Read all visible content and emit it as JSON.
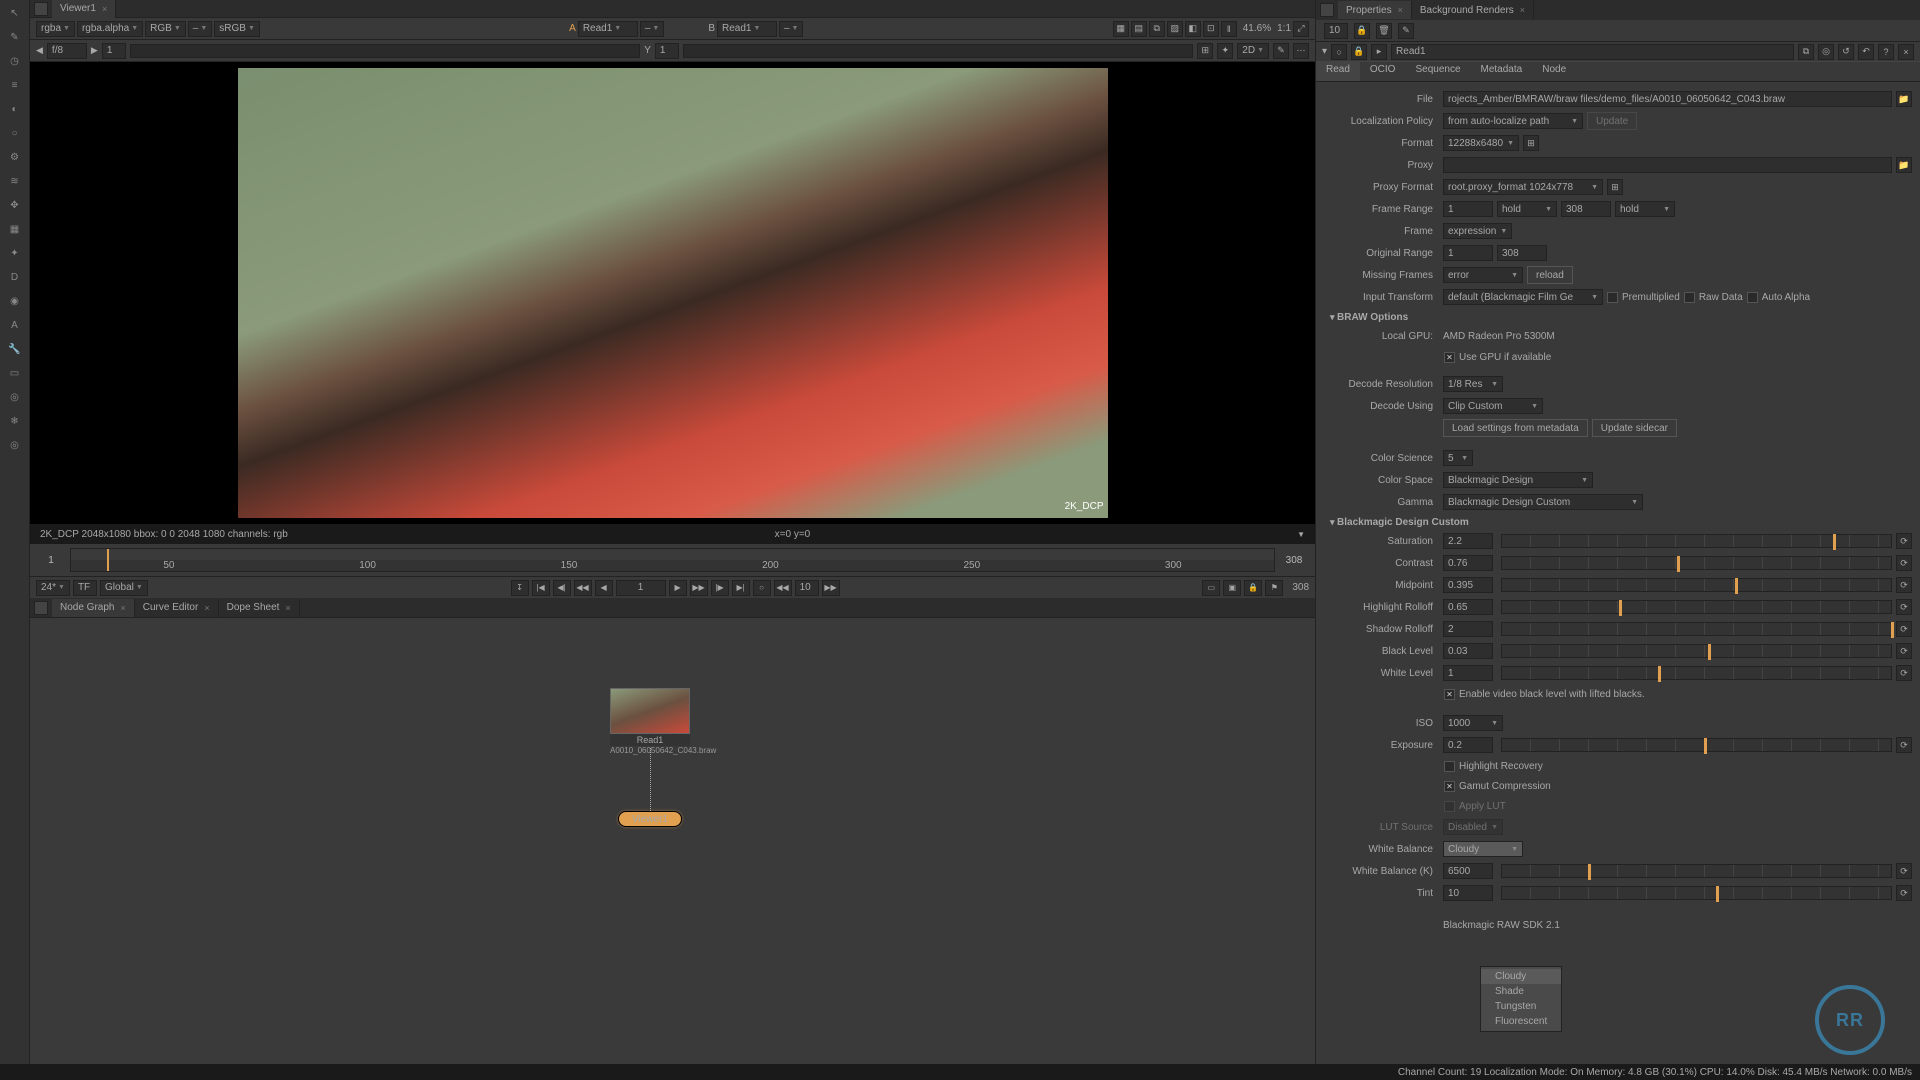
{
  "viewer_tab": "Viewer1",
  "viewer_toolbar": {
    "channel1": "rgba",
    "channel2": "rgba.alpha",
    "colorspace": "RGB",
    "display_lut": "sRGB",
    "a_label": "A",
    "a_node": "Read1",
    "b_label": "B",
    "b_node": "Read1",
    "gain_pct": "41.6%",
    "ratio": "1:1"
  },
  "viewer_toolbar2": {
    "fstop": "f/8",
    "frame": "1",
    "y_label": "Y",
    "y_val": "1",
    "view_mode": "2D"
  },
  "overlay": {
    "right": "2K_DCP"
  },
  "info_bar": {
    "left": "2K_DCP 2048x1080  bbox: 0 0 2048 1080 channels: rgb",
    "right": "x=0 y=0"
  },
  "timeline": {
    "start": "1",
    "end": "308",
    "ticks": [
      "50",
      "100",
      "150",
      "200",
      "250",
      "300"
    ],
    "frame_end": "308"
  },
  "playbar": {
    "fps": "24*",
    "tc": "TF",
    "scope": "Global",
    "current": "1",
    "skip": "10",
    "end": "308"
  },
  "lower_tabs": {
    "node_graph": "Node Graph",
    "curve_editor": "Curve Editor",
    "dope_sheet": "Dope Sheet"
  },
  "nodes": {
    "read_name": "Read1",
    "read_file": "A0010_06050642_C043.braw",
    "viewer_name": "Viewer1"
  },
  "right_tabs": {
    "properties": "Properties",
    "bg_renders": "Background Renders"
  },
  "right_header_num": "10",
  "prop_node": "Read1",
  "prop_tabs": {
    "read": "Read",
    "ocio": "OCIO",
    "sequence": "Sequence",
    "metadata": "Metadata",
    "node": "Node"
  },
  "props": {
    "file_label": "File",
    "file_value": "rojects_Amber/BMRAW/braw files/demo_files/A0010_06050642_C043.braw",
    "loc_policy_label": "Localization Policy",
    "loc_policy_value": "from auto-localize path",
    "update_btn": "Update",
    "format_label": "Format",
    "format_value": "12288x6480",
    "proxy_label": "Proxy",
    "proxy_format_label": "Proxy Format",
    "proxy_format_value": "root.proxy_format 1024x778",
    "frame_range_label": "Frame Range",
    "frame_range_a": "1",
    "frame_range_hold1": "hold",
    "frame_range_b": "308",
    "frame_range_hold2": "hold",
    "frame_label": "Frame",
    "frame_value": "expression",
    "orig_range_label": "Original Range",
    "orig_range_a": "1",
    "orig_range_b": "308",
    "missing_label": "Missing Frames",
    "missing_value": "error",
    "reload_btn": "reload",
    "input_xform_label": "Input Transform",
    "input_xform_value": "default (Blackmagic Film Ge",
    "premult": "Premultiplied",
    "raw_data": "Raw Data",
    "auto_alpha": "Auto Alpha",
    "braw_section": "BRAW Options",
    "local_gpu_label": "Local GPU:",
    "local_gpu_value": "AMD Radeon Pro 5300M",
    "use_gpu": "Use GPU if available",
    "decode_res_label": "Decode Resolution",
    "decode_res_value": "1/8 Res",
    "decode_using_label": "Decode Using",
    "decode_using_value": "Clip Custom",
    "load_settings_btn": "Load settings from metadata",
    "update_sidecar_btn": "Update sidecar",
    "color_science_label": "Color Science",
    "color_science_value": "5",
    "color_space_label": "Color Space",
    "color_space_value": "Blackmagic Design",
    "gamma_label": "Gamma",
    "gamma_value": "Blackmagic Design Custom",
    "bmd_custom_section": "Blackmagic Design Custom",
    "saturation_label": "Saturation",
    "saturation_value": "2.2",
    "contrast_label": "Contrast",
    "contrast_value": "0.76",
    "midpoint_label": "Midpoint",
    "midpoint_value": "0.395",
    "hl_rolloff_label": "Highlight Rolloff",
    "hl_rolloff_value": "0.65",
    "sh_rolloff_label": "Shadow Rolloff",
    "sh_rolloff_value": "2",
    "black_level_label": "Black Level",
    "black_level_value": "0.03",
    "white_level_label": "White Level",
    "white_level_value": "1",
    "enable_video_black": "Enable video black level with lifted blacks.",
    "iso_label": "ISO",
    "iso_value": "1000",
    "exposure_label": "Exposure",
    "exposure_value": "0.2",
    "hl_recovery": "Highlight Recovery",
    "gamut_comp": "Gamut Compression",
    "apply_lut": "Apply LUT",
    "lut_source_label": "LUT Source",
    "lut_source_value": "Disabled",
    "wb_label": "White Balance",
    "wb_value": "Cloudy",
    "wb_k_label": "White Balance (K)",
    "wb_k_value": "6500",
    "tint_label": "Tint",
    "tint_value": "10",
    "sdk_label": "Blackmagic RAW SDK 2.1"
  },
  "dropdown": {
    "item1": "Cloudy",
    "item2": "Shade",
    "item3": "Tungsten",
    "item4": "Fluorescent"
  },
  "status": {
    "left": "Channel Count: 19  Localization Mode: On  Memory: 4.8 GB (30.1%)  CPU: 14.0%  Disk: 45.4 MB/s  Network: 0.0 MB/s",
    "right": ""
  }
}
